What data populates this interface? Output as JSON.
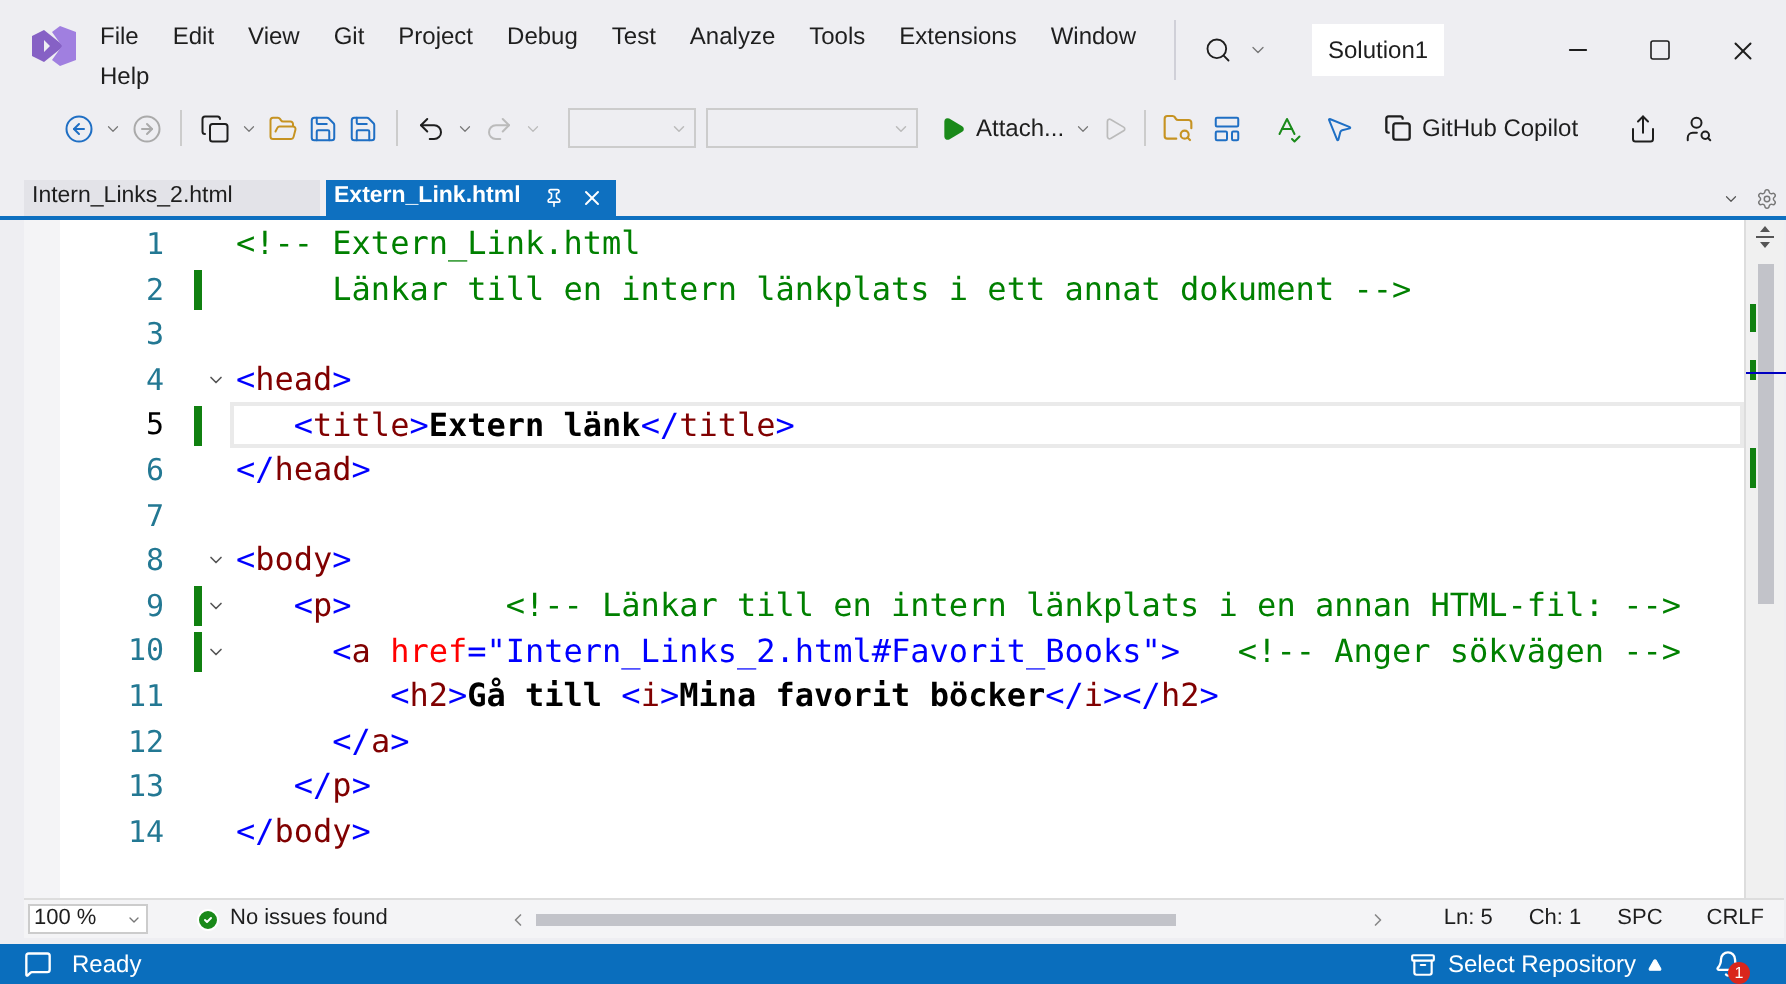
{
  "menu": [
    {
      "label": "File"
    },
    {
      "label": "Edit"
    },
    {
      "label": "View"
    },
    {
      "label": "Git"
    },
    {
      "label": "Project"
    },
    {
      "label": "Debug"
    },
    {
      "label": "Test"
    },
    {
      "label": "Analyze"
    },
    {
      "label": "Tools"
    },
    {
      "label": "Extensions"
    },
    {
      "label": "Window"
    },
    {
      "label": "Help"
    }
  ],
  "solution": "Solution1",
  "toolbar": {
    "attach": "Attach...",
    "copilot": "GitHub Copilot"
  },
  "tabs": [
    {
      "label": "Intern_Links_2.html",
      "selected": false
    },
    {
      "label": "Extern_Link.html",
      "selected": true
    }
  ],
  "editor": {
    "lines": [
      {
        "number": "1",
        "changed": false,
        "foldable": false,
        "current": false,
        "tokens": [
          {
            "kind": "comment",
            "text": "<!-- Extern_Link.html"
          }
        ]
      },
      {
        "number": "2",
        "changed": true,
        "foldable": false,
        "current": false,
        "tokens": [
          {
            "kind": "comment",
            "text": "     Länkar till en intern länkplats i ett annat dokument -->"
          }
        ]
      },
      {
        "number": "3",
        "changed": false,
        "foldable": false,
        "current": false
      },
      {
        "number": "4",
        "changed": false,
        "foldable": true,
        "current": false,
        "tokens": [
          {
            "kind": "bracket",
            "text": "<"
          },
          {
            "kind": "tag",
            "text": "head"
          },
          {
            "kind": "bracket",
            "text": ">"
          }
        ]
      },
      {
        "number": "5",
        "changed": true,
        "foldable": false,
        "current": true,
        "tokens": [
          {
            "kind": "bracket",
            "text": "   <"
          },
          {
            "kind": "tag",
            "text": "title"
          },
          {
            "kind": "bracket",
            "text": ">"
          },
          {
            "kind": "text",
            "text": "Extern länk"
          },
          {
            "kind": "bracket",
            "text": "</"
          },
          {
            "kind": "tag",
            "text": "title"
          },
          {
            "kind": "bracket",
            "text": ">"
          }
        ]
      },
      {
        "number": "6",
        "changed": false,
        "foldable": false,
        "current": false,
        "tokens": [
          {
            "kind": "bracket",
            "text": "</"
          },
          {
            "kind": "tag",
            "text": "head"
          },
          {
            "kind": "bracket",
            "text": ">"
          }
        ]
      },
      {
        "number": "7",
        "changed": false,
        "foldable": false,
        "current": false
      },
      {
        "number": "8",
        "changed": false,
        "foldable": true,
        "current": false,
        "tokens": [
          {
            "kind": "bracket",
            "text": "<"
          },
          {
            "kind": "tag",
            "text": "body"
          },
          {
            "kind": "bracket",
            "text": ">"
          }
        ]
      },
      {
        "number": "9",
        "changed": true,
        "foldable": true,
        "current": false,
        "tokens": [
          {
            "kind": "bracket",
            "text": "   <"
          },
          {
            "kind": "tag",
            "text": "p"
          },
          {
            "kind": "bracket",
            "text": ">"
          },
          {
            "kind": "comment",
            "text": "        <!-- Länkar till en intern länkplats i en annan HTML-fil: -->"
          }
        ]
      },
      {
        "number": "10",
        "changed": true,
        "foldable": true,
        "current": false,
        "tokens": [
          {
            "kind": "bracket",
            "text": "     <"
          },
          {
            "kind": "tag",
            "text": "a"
          },
          {
            "kind": "attr",
            "text": " href"
          },
          {
            "kind": "bracket",
            "text": "=\"Intern_Links_2.html#Favorit_Books\">"
          },
          {
            "kind": "comment",
            "text": "   <!-- Anger sökvägen -->"
          }
        ]
      },
      {
        "number": "11",
        "changed": false,
        "foldable": false,
        "current": false,
        "tokens": [
          {
            "kind": "bracket",
            "text": "        <"
          },
          {
            "kind": "tag",
            "text": "h2"
          },
          {
            "kind": "bracket",
            "text": ">"
          },
          {
            "kind": "text",
            "text": "Gå till "
          },
          {
            "kind": "bracket",
            "text": "<"
          },
          {
            "kind": "tag",
            "text": "i"
          },
          {
            "kind": "bracket",
            "text": ">"
          },
          {
            "kind": "text",
            "text": "Mina favorit böcker"
          },
          {
            "kind": "bracket",
            "text": "</"
          },
          {
            "kind": "tag",
            "text": "i"
          },
          {
            "kind": "bracket",
            "text": "></"
          },
          {
            "kind": "tag",
            "text": "h2"
          },
          {
            "kind": "bracket",
            "text": ">"
          }
        ]
      },
      {
        "number": "12",
        "changed": false,
        "foldable": false,
        "current": false,
        "tokens": [
          {
            "kind": "bracket",
            "text": "     </"
          },
          {
            "kind": "tag",
            "text": "a"
          },
          {
            "kind": "bracket",
            "text": ">"
          }
        ]
      },
      {
        "number": "13",
        "changed": false,
        "foldable": false,
        "current": false,
        "tokens": [
          {
            "kind": "bracket",
            "text": "   </"
          },
          {
            "kind": "tag",
            "text": "p"
          },
          {
            "kind": "bracket",
            "text": ">"
          }
        ]
      },
      {
        "number": "14",
        "changed": false,
        "foldable": false,
        "current": false,
        "tokens": [
          {
            "kind": "bracket",
            "text": "</"
          },
          {
            "kind": "tag",
            "text": "body"
          },
          {
            "kind": "bracket",
            "text": ">"
          }
        ]
      }
    ]
  },
  "bottom_bar": {
    "zoom": "100 %",
    "issues": "No issues found",
    "line": "Ln: 5",
    "column": "Ch: 1",
    "whitespace": "SPC",
    "line_ending": "CRLF"
  },
  "status_bar": {
    "state": "Ready",
    "repository": "Select Repository",
    "notifications": "1"
  }
}
